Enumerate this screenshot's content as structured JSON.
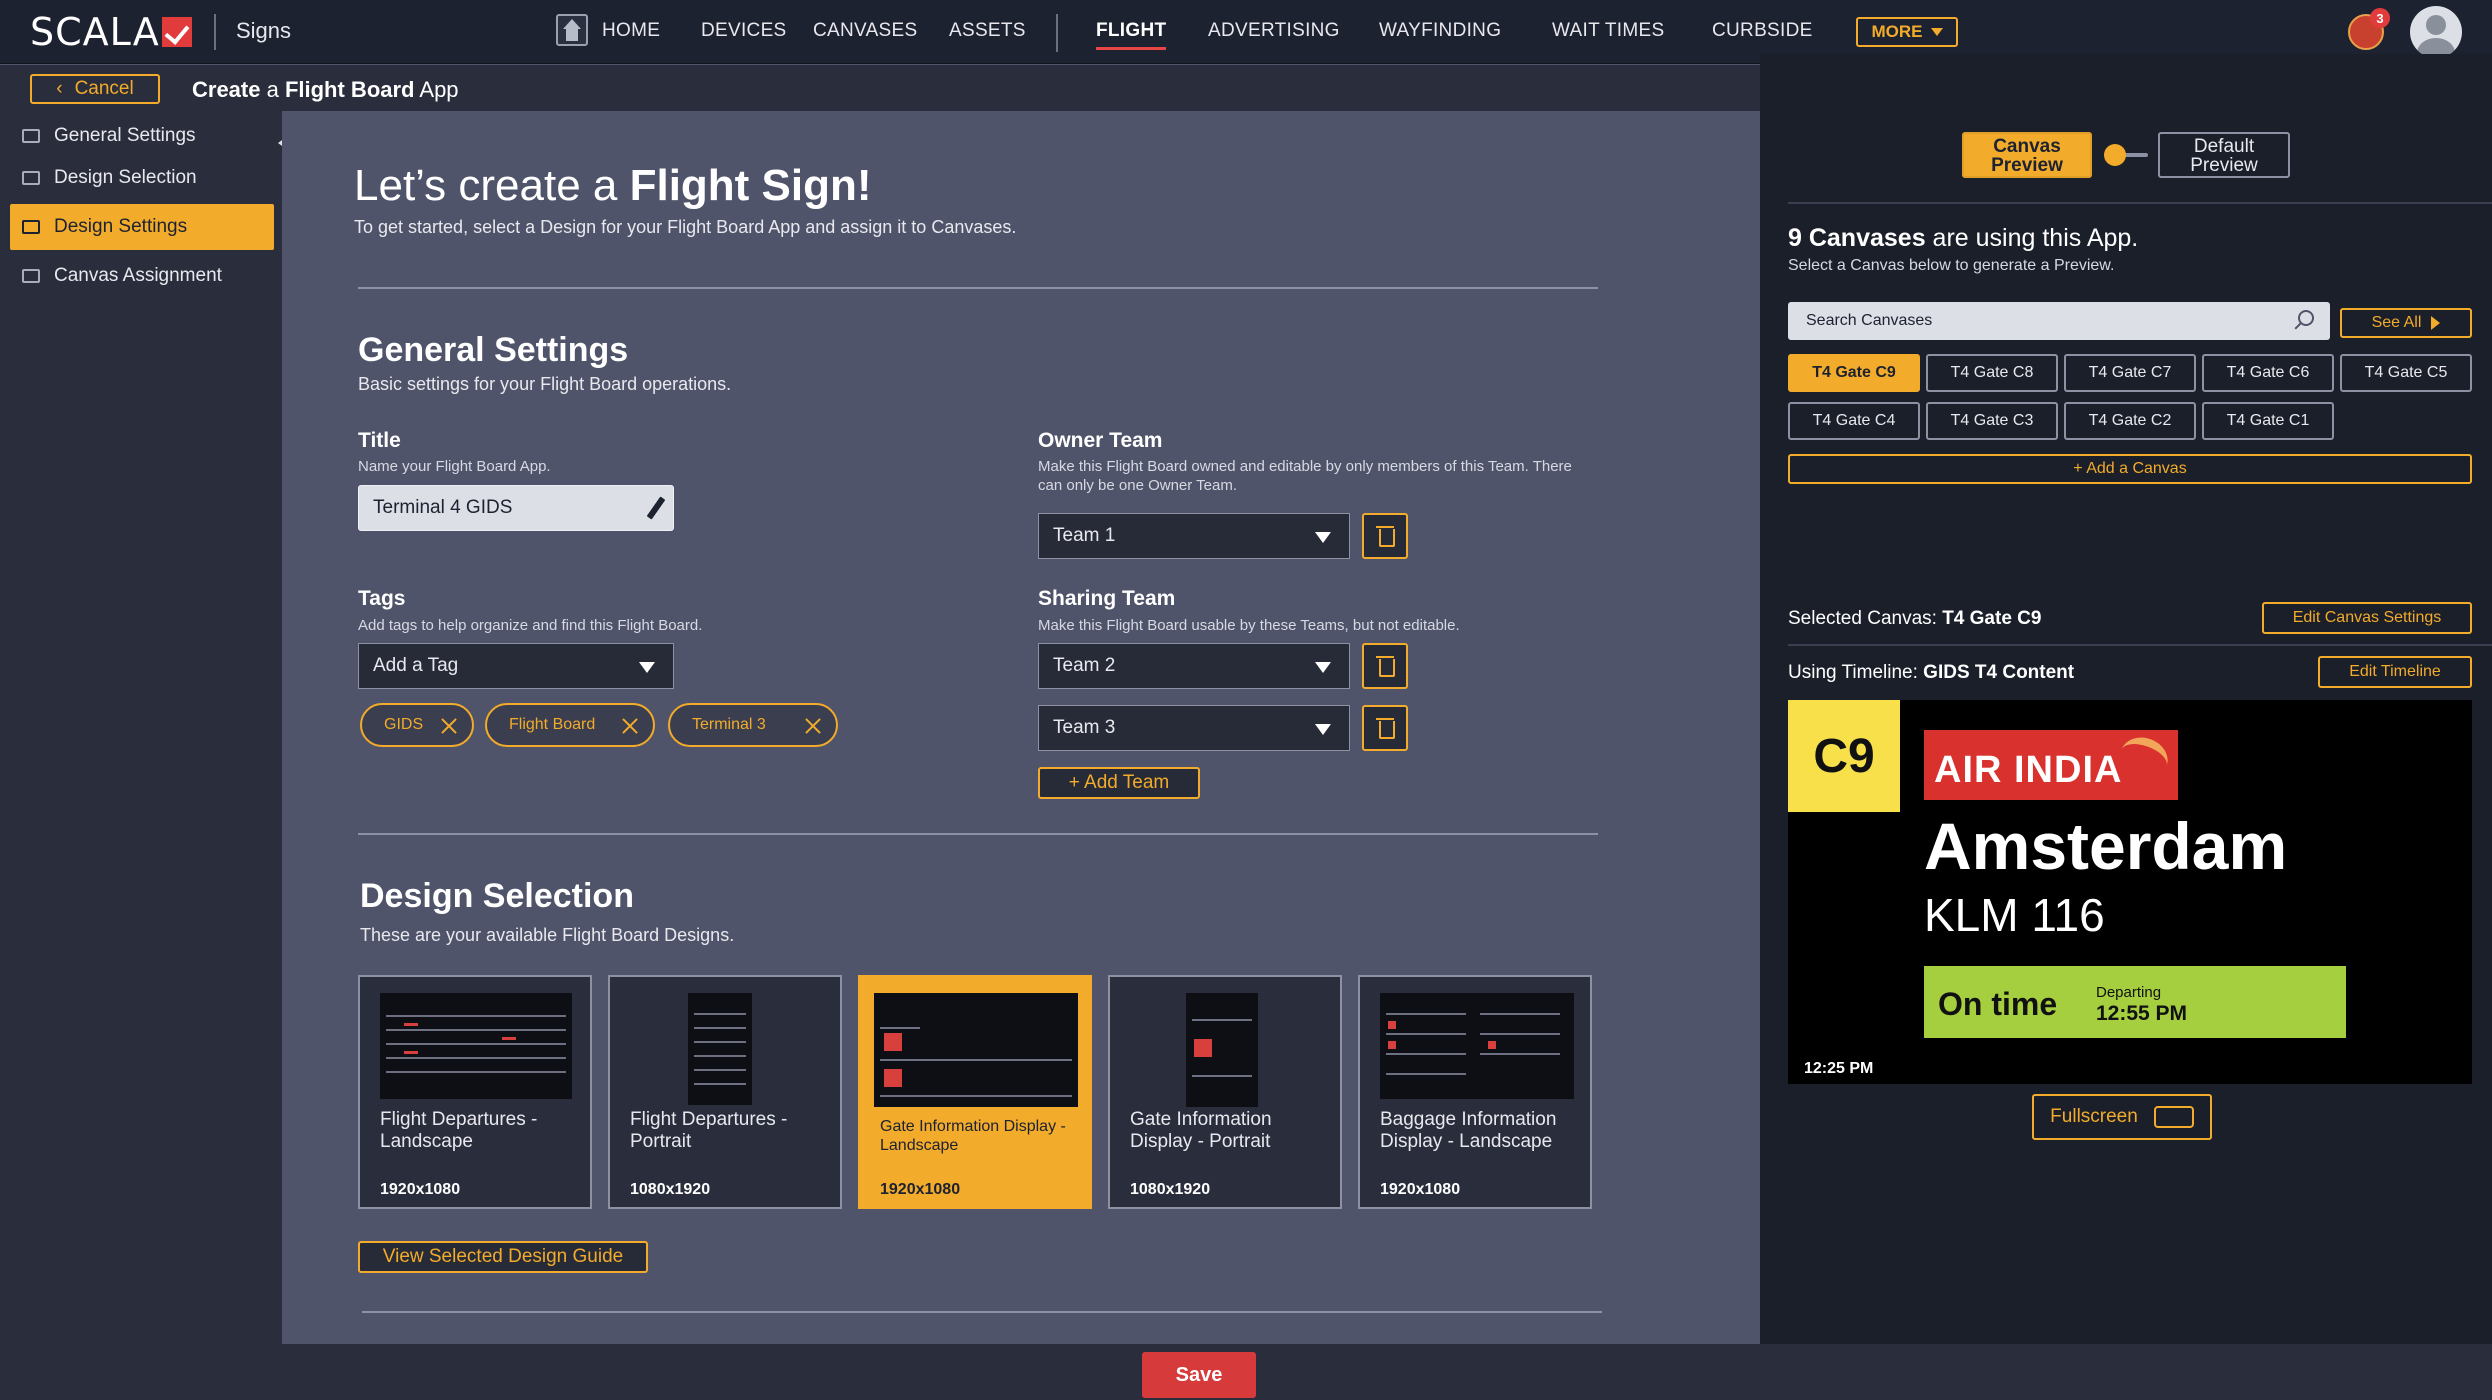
{
  "app": {
    "logo_text": "SCALA",
    "product": "Signs"
  },
  "nav": {
    "items": [
      "HOME",
      "DEVICES",
      "CANVASES",
      "ASSETS",
      "FLIGHT",
      "ADVERTISING",
      "WAYFINDING",
      "WAIT TIMES",
      "CURBSIDE"
    ],
    "active": "FLIGHT",
    "more_label": "MORE",
    "notification_count": "3",
    "accent_color": "#f2ab2a",
    "active_underline_color": "#e84545"
  },
  "subheader": {
    "cancel_label": "Cancel",
    "title_prefix": "Create",
    "title_mid": " a ",
    "title_bold": "Flight Board",
    "title_suffix": " App"
  },
  "sidebar": {
    "items": [
      {
        "label": "General Settings",
        "icon": "list-icon",
        "active": false
      },
      {
        "label": "Design Selection",
        "icon": "panel-icon",
        "active": false
      },
      {
        "label": "Design Settings",
        "icon": "columns-icon",
        "active": true
      },
      {
        "label": "Canvas Assignment",
        "icon": "canvases-icon",
        "active": false
      }
    ]
  },
  "hero": {
    "title_normal": "Let’s create a ",
    "title_bold": "Flight Sign!",
    "subtitle": "To get started, select a Design for your Flight Board App and assign it to Canvases."
  },
  "general_settings": {
    "title": "General Settings",
    "subtitle": "Basic settings for your Flight Board operations.",
    "title_field": {
      "label": "Title",
      "help": "Name your Flight Board App.",
      "value": "Terminal 4 GIDS"
    },
    "owner_team": {
      "label": "Owner Team",
      "help": "Make this Flight Board owned and editable by only members of this Team. There can only be one Owner Team.",
      "value": "Team 1"
    },
    "tags": {
      "label": "Tags",
      "help": "Add tags to help organize and find this Flight Board.",
      "placeholder": "Add a Tag",
      "chips": [
        "GIDS",
        "Flight Board",
        "Terminal 3"
      ]
    },
    "sharing_team": {
      "label": "Sharing Team",
      "help": "Make this Flight Board usable by these Teams, but not editable.",
      "values": [
        "Team 2",
        "Team 3"
      ],
      "add_label": "+ Add Team"
    }
  },
  "design_selection": {
    "title": "Design Selection",
    "subtitle": "These are your available Flight Board Designs.",
    "cards": [
      {
        "name": "Flight Departures - Landscape",
        "resolution": "1920x1080",
        "selected": false
      },
      {
        "name": "Flight Departures - Portrait",
        "resolution": "1080x1920",
        "selected": false
      },
      {
        "name": "Gate Information Display - Landscape",
        "resolution": "1920x1080",
        "selected": true
      },
      {
        "name": "Gate Information Display - Portrait",
        "resolution": "1080x1920",
        "selected": false
      },
      {
        "name": "Baggage Information Display - Landscape",
        "resolution": "1920x1080",
        "selected": false
      }
    ],
    "guide_label": "View Selected Design Guide"
  },
  "right_panel": {
    "canvas_preview_label": "Canvas Preview",
    "default_preview_label": "Default Preview",
    "canvases_count": "9 Canvases",
    "canvases_heading_suffix": " are using this App.",
    "canvases_sub": "Select a Canvas below to generate a Preview.",
    "search_placeholder": "Search Canvases",
    "see_all_label": "See All",
    "canvases": [
      "T4 Gate C9",
      "T4 Gate C8",
      "T4 Gate C7",
      "T4 Gate C6",
      "T4 Gate C5",
      "T4 Gate C4",
      "T4 Gate C3",
      "T4 Gate C2",
      "T4 Gate C1"
    ],
    "active_canvas": "T4 Gate C9",
    "add_canvas_label": "+ Add a Canvas",
    "selected_canvas_label": "Selected Canvas: ",
    "selected_canvas_value": "T4 Gate C9",
    "edit_canvas_label": "Edit Canvas Settings",
    "timeline_label": "Using Timeline: ",
    "timeline_value": "GIDS T4 Content",
    "edit_timeline_label": "Edit Timeline",
    "fullscreen_label": "Fullscreen"
  },
  "preview": {
    "gate": "C9",
    "airline": "AIR INDIA",
    "destination": "Amsterdam",
    "flight": "KLM 116",
    "status": "On time",
    "departing_label": "Departing",
    "departing_time": "12:55 PM",
    "clock": "12:25 PM",
    "status_color": "#a5cf3f",
    "gate_color": "#f7e04a",
    "airline_color": "#d9322e"
  },
  "footer": {
    "save_label": "Save",
    "save_color": "#d63a3a"
  }
}
